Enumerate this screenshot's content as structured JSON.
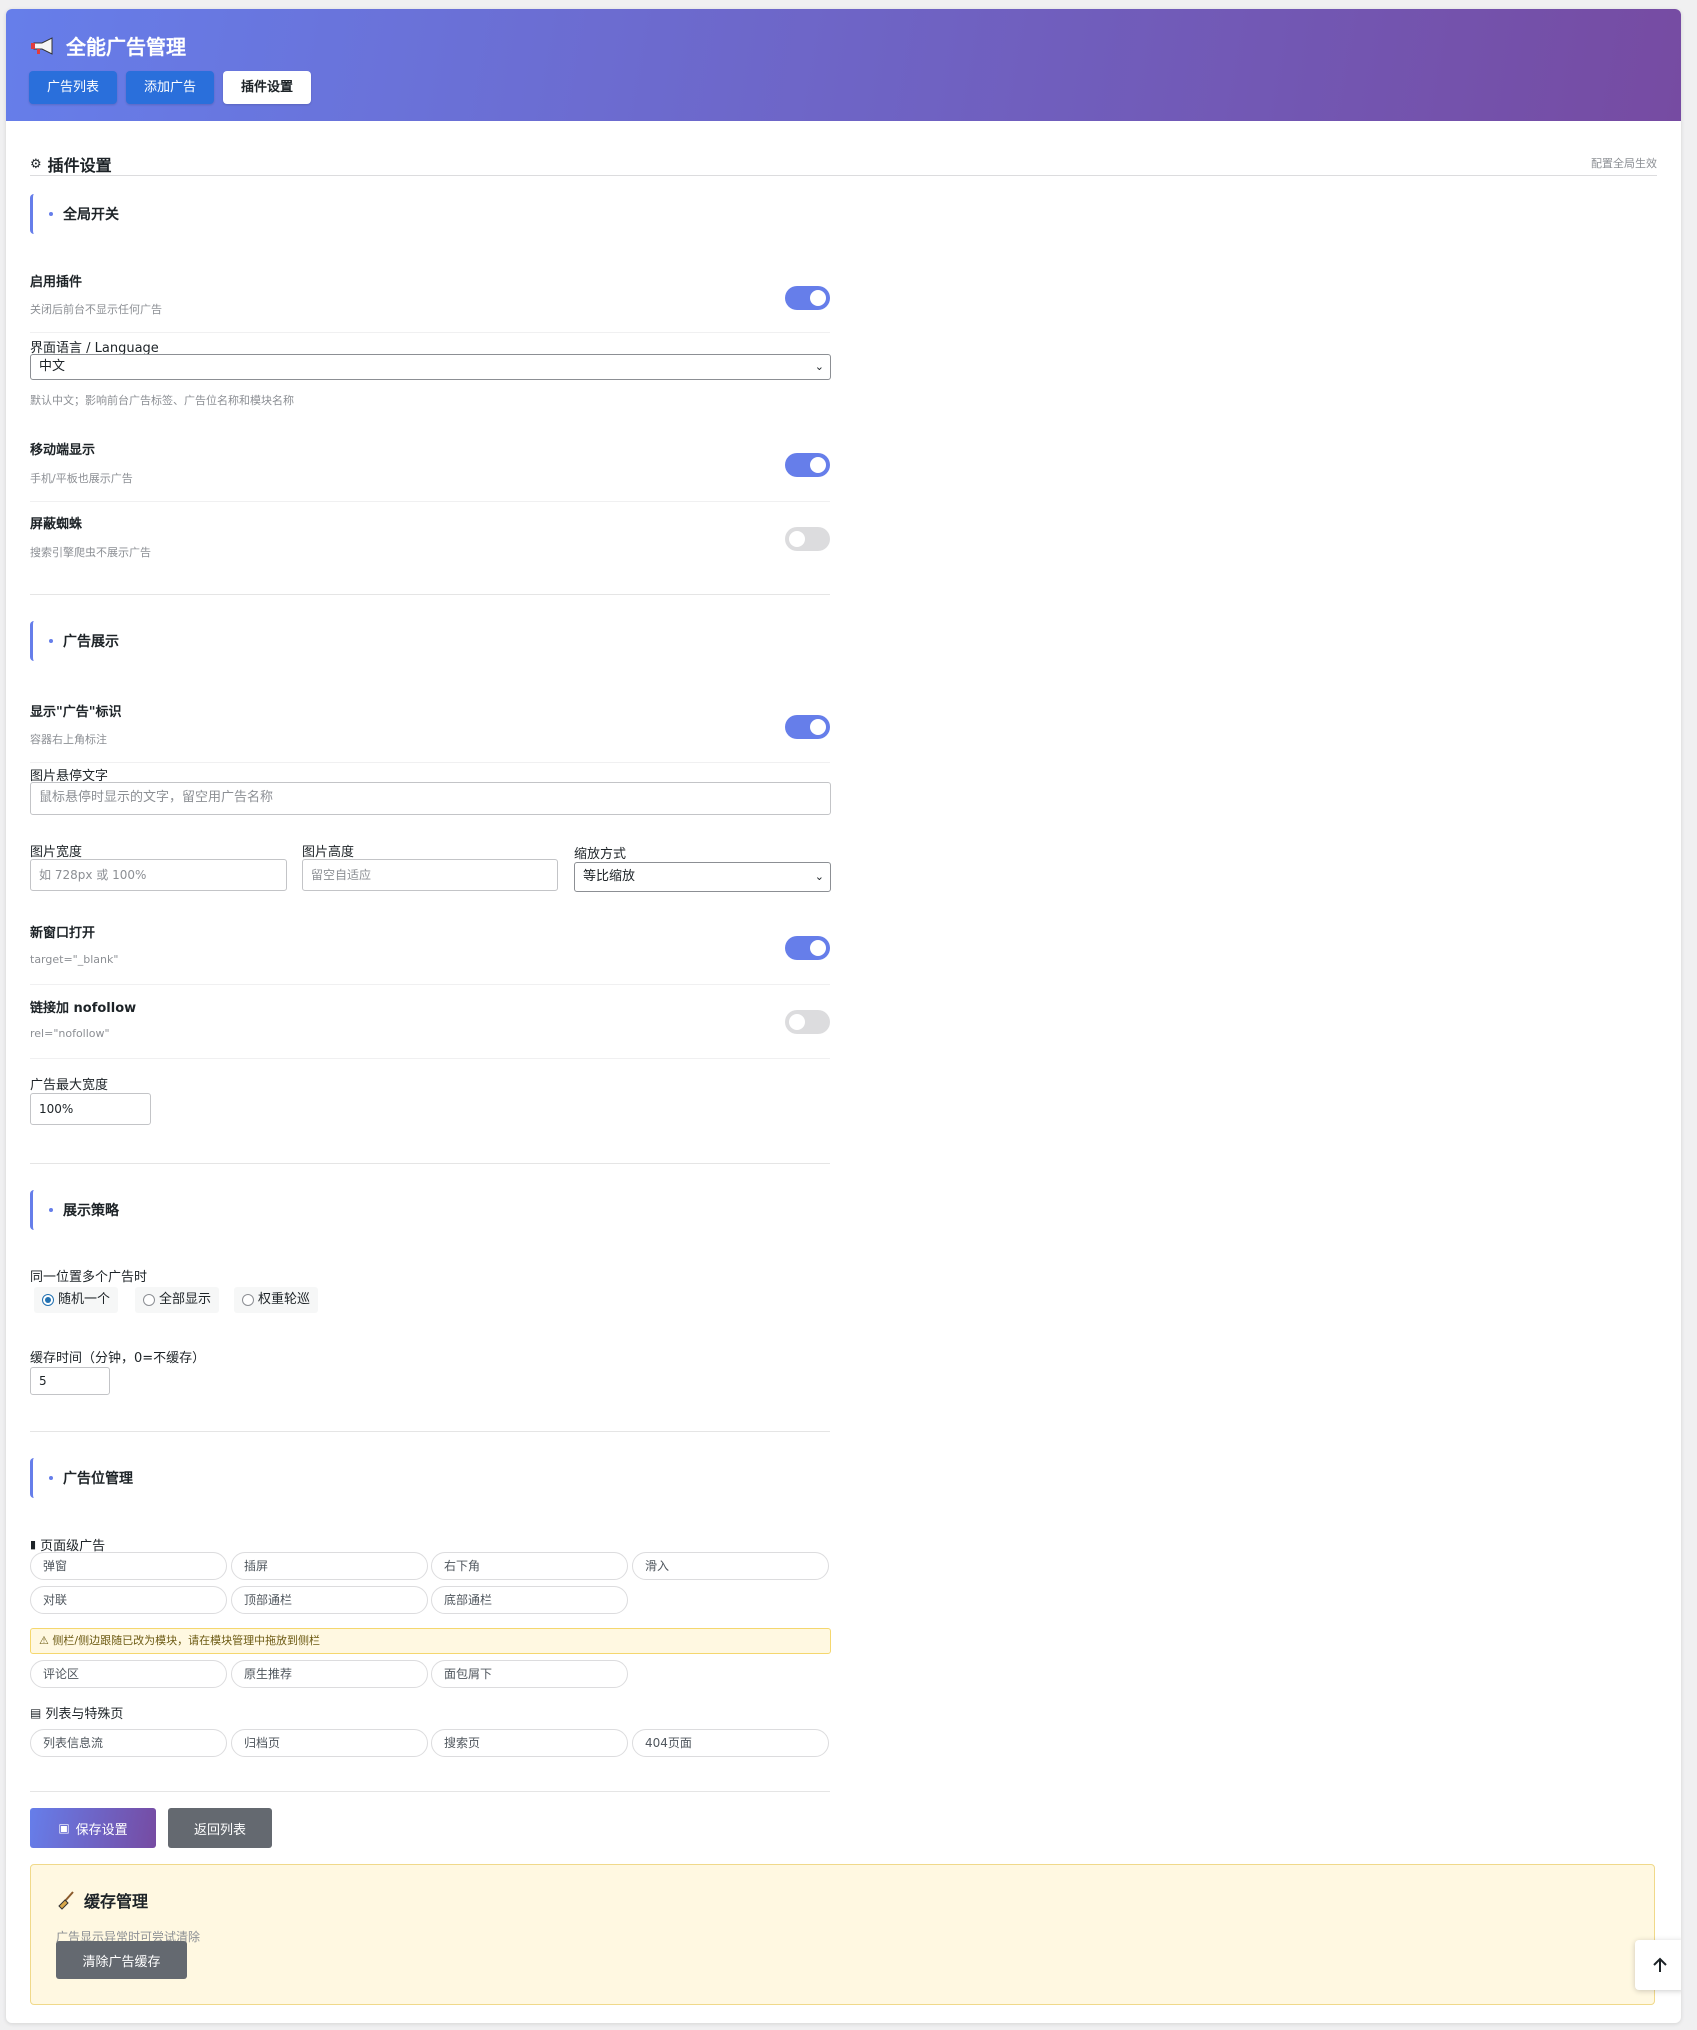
{
  "header": {
    "title": "全能广告管理",
    "tabs": [
      "广告列表",
      "添加广告",
      "插件设置"
    ],
    "active_tab": "插件设置"
  },
  "section": {
    "title": "插件设置",
    "note": "配置全局生效"
  },
  "groups": {
    "global": "全局开关",
    "display": "广告展示",
    "strategy": "展示策略",
    "positions": "广告位管理"
  },
  "global": {
    "enable": {
      "label": "启用插件",
      "desc": "关闭后前台不显示任何广告",
      "on": true
    },
    "language": {
      "label": "界面语言 / Language",
      "value": "中文",
      "desc": "默认中文；影响前台广告标签、广告位名称和模块名称"
    },
    "mobile": {
      "label": "移动端显示",
      "desc": "手机/平板也展示广告",
      "on": true
    },
    "spider": {
      "label": "屏蔽蜘蛛",
      "desc": "搜索引擎爬虫不展示广告",
      "on": false
    }
  },
  "display": {
    "badge": {
      "label": "显示\"广告\"标识",
      "desc": "容器右上角标注",
      "on": true
    },
    "hover": {
      "label": "图片悬停文字",
      "placeholder": "鼠标悬停时显示的文字，留空用广告名称"
    },
    "width": {
      "label": "图片宽度",
      "placeholder": "如 728px 或 100%"
    },
    "height": {
      "label": "图片高度",
      "placeholder": "留空自适应"
    },
    "scale": {
      "label": "缩放方式",
      "value": "等比缩放"
    },
    "newwin": {
      "label": "新窗口打开",
      "desc": "target=\"_blank\"",
      "on": true
    },
    "nofollow": {
      "label": "链接加 nofollow",
      "desc": "rel=\"nofollow\"",
      "on": false
    },
    "maxwidth": {
      "label": "广告最大宽度",
      "value": "100%"
    }
  },
  "strategy": {
    "multi_label": "同一位置多个广告时",
    "options": [
      "随机一个",
      "全部显示",
      "权重轮巡"
    ],
    "selected": "随机一个",
    "cache_label": "缓存时间（分钟，0=不缓存）",
    "cache_value": "5"
  },
  "positions": {
    "page_title": "页面级广告",
    "page_items": [
      "弹窗",
      "插屏",
      "右下角",
      "滑入",
      "对联",
      "顶部通栏",
      "底部通栏"
    ],
    "warning": "⚠ 侧栏/侧边跟随已改为模块，请在模块管理中拖放到侧栏",
    "extra_items": [
      "评论区",
      "原生推荐",
      "面包屑下"
    ],
    "list_title": "列表与特殊页",
    "list_items": [
      "列表信息流",
      "归档页",
      "搜索页",
      "404页面"
    ]
  },
  "actions": {
    "save": "保存设置",
    "back": "返回列表"
  },
  "cache": {
    "title": "缓存管理",
    "desc": "广告显示异常时可尝试清除",
    "button": "清除广告缓存"
  },
  "colors": {
    "accent": "#667eea",
    "header_end": "#764ba2",
    "tab_blue": "#2a6fdb",
    "gray_btn": "#646970"
  },
  "icons": [
    "megaphone-icon",
    "gear-icon",
    "phone-icon",
    "clipboard-icon",
    "floppy-icon",
    "broom-icon",
    "arrow-up-icon"
  ]
}
